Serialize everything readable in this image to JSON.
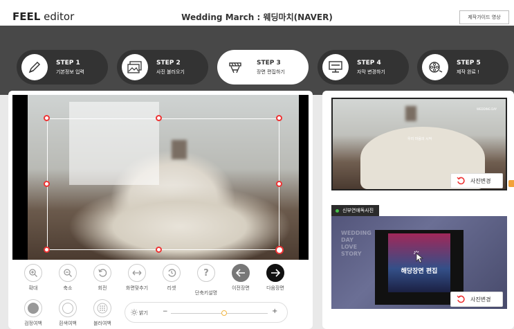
{
  "header": {
    "logo_bold": "FEEL",
    "logo_light": "editor",
    "title": "Wedding March : 웨딩마치(NAVER)",
    "guide_button": "제작가이드 영상"
  },
  "steps": [
    {
      "num": "STEP 1",
      "label": "기본정보 입력",
      "icon": "pen-icon"
    },
    {
      "num": "STEP 2",
      "label": "사진 불러오기",
      "icon": "photos-icon"
    },
    {
      "num": "STEP 3",
      "label": "장면 편집하기",
      "icon": "clapper-icon"
    },
    {
      "num": "STEP 4",
      "label": "자막 변경하기",
      "icon": "monitor-icon"
    },
    {
      "num": "STEP 5",
      "label": "제작 완료 !",
      "icon": "film-reel-icon"
    }
  ],
  "tools": {
    "zoom_in": "확대",
    "zoom_out": "축소",
    "rotate": "회전",
    "fit": "화면맞추기",
    "reset": "리셋",
    "shortcuts": "단축키설명",
    "prev_scene": "이전장면",
    "next_scene": "다음장면",
    "black_margin": "검정여백",
    "white_margin": "흰색여백",
    "blur_margin": "블러여백"
  },
  "brightness": {
    "label": "밝기",
    "minus": "−",
    "plus": "+",
    "value": 0.55
  },
  "side": {
    "thumb1_text": "우리 마음의 시작",
    "thumb1_corner": "WEDDING DAY",
    "change_photo": "사진변경",
    "scene_label": "신부연애독사진",
    "scene_title": "해당장면 편집",
    "scene_side_text": "WEDDING DAY LOVE STORY"
  },
  "colors": {
    "header_bg": "#ffffff",
    "step_band": "#484848",
    "step_pill": "#333333",
    "accent_red": "#e33333",
    "accent_green": "#46c04a",
    "accent_orange": "#f2a23a"
  }
}
